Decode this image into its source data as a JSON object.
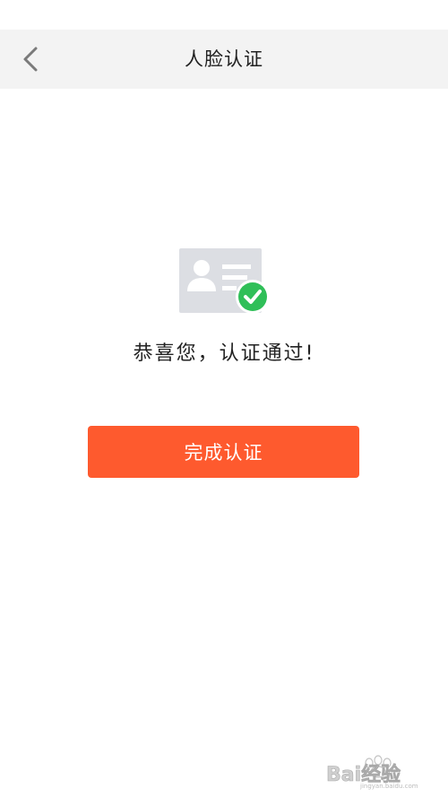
{
  "header": {
    "title": "人脸认证",
    "back_icon": "chevron-left-icon"
  },
  "main": {
    "illustration_icon": "id-card-verified-icon",
    "message": "恭喜您，认证通过!",
    "complete_button_label": "完成认证"
  },
  "watermark": {
    "text": "Bai经验",
    "sub_text": "jingyan.baidu.com"
  },
  "colors": {
    "nav_background": "#f3f3f3",
    "accent": "#fe5a2e",
    "success_check": "#2fbf58",
    "card_gray": "#dcdee3"
  }
}
